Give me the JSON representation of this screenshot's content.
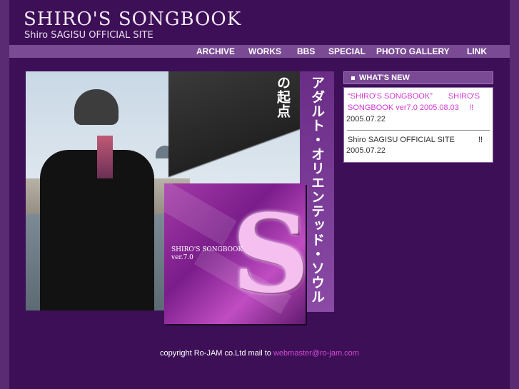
{
  "header": {
    "title": "SHIRO'S SONGBOOK",
    "subtitle": "Shiro SAGISU OFFICIAL SITE"
  },
  "nav": {
    "items": [
      {
        "label": "ARCHIVE"
      },
      {
        "label": "WORKS"
      },
      {
        "label": "BBS"
      },
      {
        "label": "SPECIAL"
      },
      {
        "label": "PHOTO GALLERY"
      },
      {
        "label": "LINK"
      }
    ]
  },
  "banner": {
    "vertical_text": "アダルト・オリエンテッド・ソウルの起点"
  },
  "cd": {
    "title": "SHIRO'S SONGBOOK",
    "version": "ver.7.0",
    "logo_glyph": "S"
  },
  "whats_new": {
    "heading": "WHAT'S NEW",
    "items": [
      {
        "text": "“SHIRO'S SONGBOOK”　　SHIRO'S SONGBOOK ver7.0 2005.08.03　 !!",
        "date": "2005.07.22"
      },
      {
        "text": "Shiro SAGISU OFFICIAL SITE　　　!!",
        "date": "2005.07.22"
      }
    ]
  },
  "footer": {
    "copyright": "copyright Ro-JAM co.Ltd mail to ",
    "email": "webmaster@ro-jam.com"
  },
  "colors": {
    "background": "#3a0f52",
    "nav_bar": "#7a4a95",
    "link_pink": "#d33ad3"
  }
}
